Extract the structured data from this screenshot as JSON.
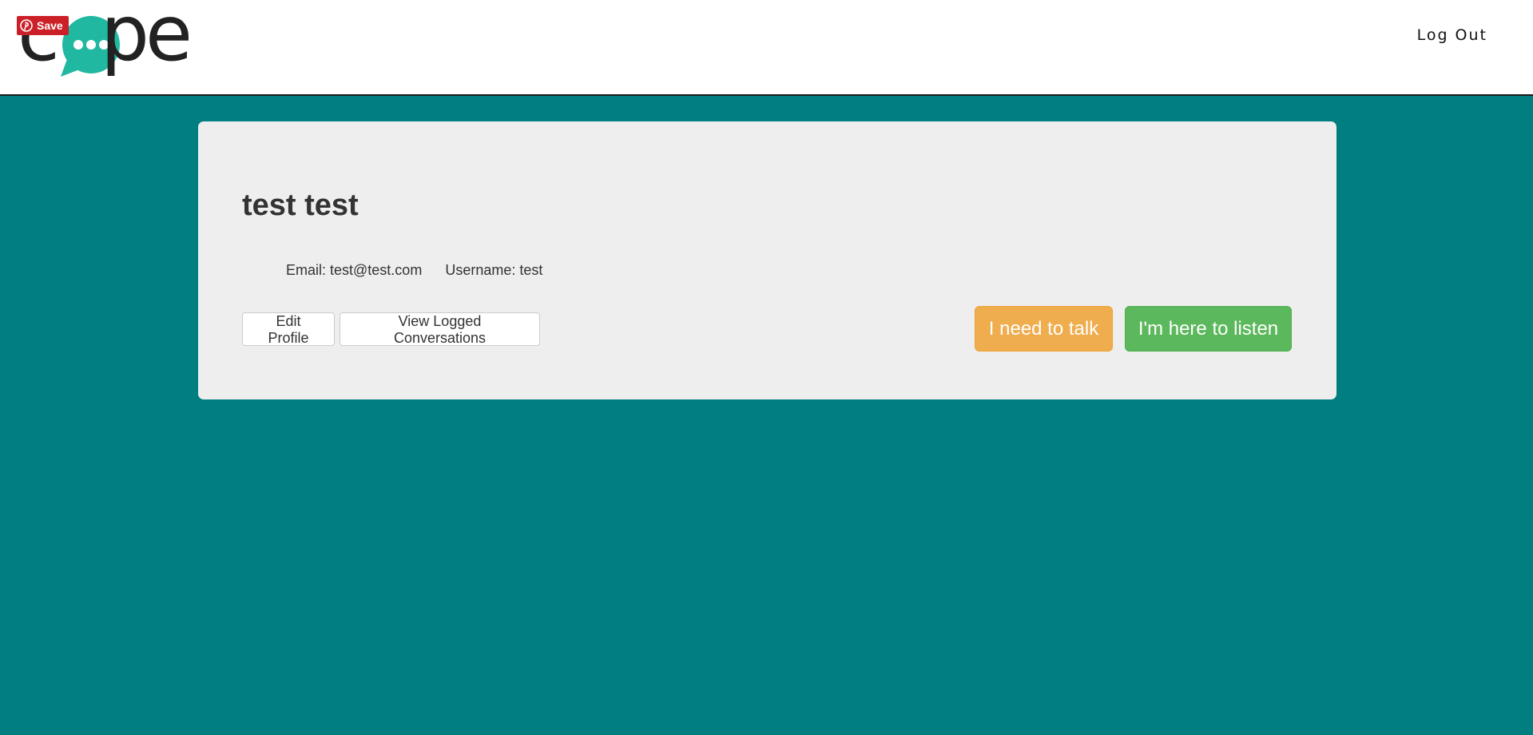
{
  "header": {
    "logo": {
      "text": "cope",
      "bubble_color": "#20b8a0"
    },
    "pin_save": {
      "label": "Save",
      "icon": "pinterest-icon",
      "color": "#cb2027"
    },
    "logout_label": "Log Out"
  },
  "profile": {
    "name": "test test",
    "email_label": "Email: test@test.com",
    "username_label": "Username: test",
    "edit_label": "Edit Profile",
    "view_conversations_label": "View Logged Conversations",
    "talk_label": "I need to talk",
    "listen_label": "I'm here to listen"
  },
  "colors": {
    "background": "#017f80",
    "card": "#eeeeee",
    "warning": "#f0ad4e",
    "success": "#5cb85c"
  }
}
